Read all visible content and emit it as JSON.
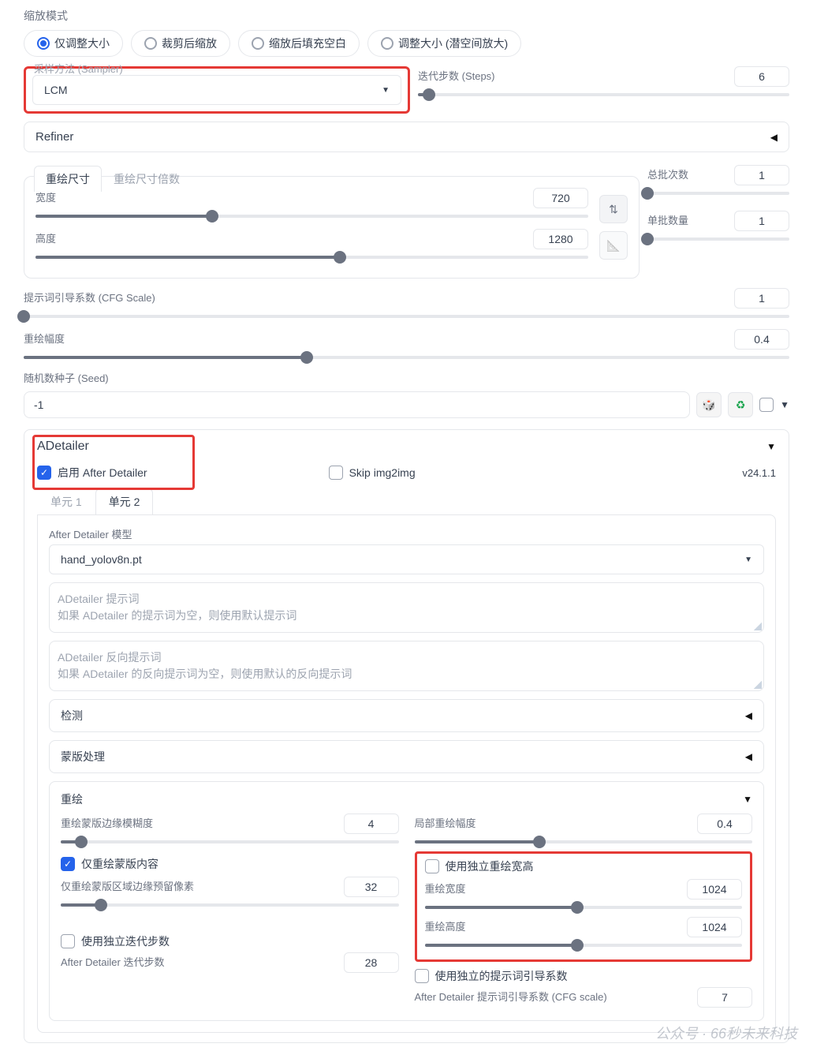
{
  "resizeMode": {
    "label": "缩放模式",
    "options": [
      "仅调整大小",
      "裁剪后缩放",
      "缩放后填充空白",
      "调整大小 (潜空间放大)"
    ],
    "selected": 0
  },
  "sampler": {
    "label": "采样方法 (Sampler)",
    "value": "LCM"
  },
  "steps": {
    "label": "迭代步数 (Steps)",
    "value": 6,
    "pct": 3
  },
  "refiner": {
    "label": "Refiner"
  },
  "resizeTabs": {
    "active": "重绘尺寸",
    "inactive": "重绘尺寸倍数"
  },
  "width": {
    "label": "宽度",
    "value": 720,
    "pct": 32
  },
  "height": {
    "label": "高度",
    "value": 1280,
    "pct": 55
  },
  "batchCount": {
    "label": "总批次数",
    "value": 1,
    "pct": 0
  },
  "batchSize": {
    "label": "单批数量",
    "value": 1,
    "pct": 0
  },
  "cfg": {
    "label": "提示词引导系数 (CFG Scale)",
    "value": 1,
    "pct": 0
  },
  "denoise": {
    "label": "重绘幅度",
    "value": 0.4,
    "pct": 37
  },
  "seed": {
    "label": "随机数种子 (Seed)",
    "value": "-1"
  },
  "adetailer": {
    "title": "ADetailer",
    "enable": "启用 After Detailer",
    "skip": "Skip img2img",
    "version": "v24.1.1",
    "tabs": {
      "u1": "单元 1",
      "u2": "单元 2"
    },
    "modelLabel": "After Detailer 模型",
    "model": "hand_yolov8n.pt",
    "prompt": {
      "t": "ADetailer 提示词",
      "p": "如果 ADetailer 的提示词为空，则使用默认提示词"
    },
    "negPrompt": {
      "t": "ADetailer 反向提示词",
      "p": "如果 ADetailer 的反向提示词为空，则使用默认的反向提示词"
    },
    "detect": "检测",
    "mask": "蒙版处理",
    "repaint": {
      "title": "重绘",
      "blur": {
        "label": "重绘蒙版边缘模糊度",
        "value": 4,
        "pct": 6
      },
      "onlyMask": "仅重绘蒙版内容",
      "padding": {
        "label": "仅重绘蒙版区域边缘预留像素",
        "value": 32,
        "pct": 12
      },
      "localDenoise": {
        "label": "局部重绘幅度",
        "value": 0.4,
        "pct": 37
      },
      "useSize": "使用独立重绘宽高",
      "rw": {
        "label": "重绘宽度",
        "value": 1024,
        "pct": 48
      },
      "rh": {
        "label": "重绘高度",
        "value": 1024,
        "pct": 48
      },
      "useSteps": "使用独立迭代步数",
      "adSteps": {
        "label": "After Detailer 迭代步数",
        "value": 28
      },
      "useCfg": "使用独立的提示词引导系数",
      "adCfg": {
        "label": "After Detailer 提示词引导系数 (CFG scale)",
        "value": 7
      }
    }
  },
  "icons": {
    "dice": "🎲",
    "recycle": "♻",
    "swap": "⇅",
    "ruler": "📐"
  },
  "watermark": "公众号 · 66秒未来科技"
}
